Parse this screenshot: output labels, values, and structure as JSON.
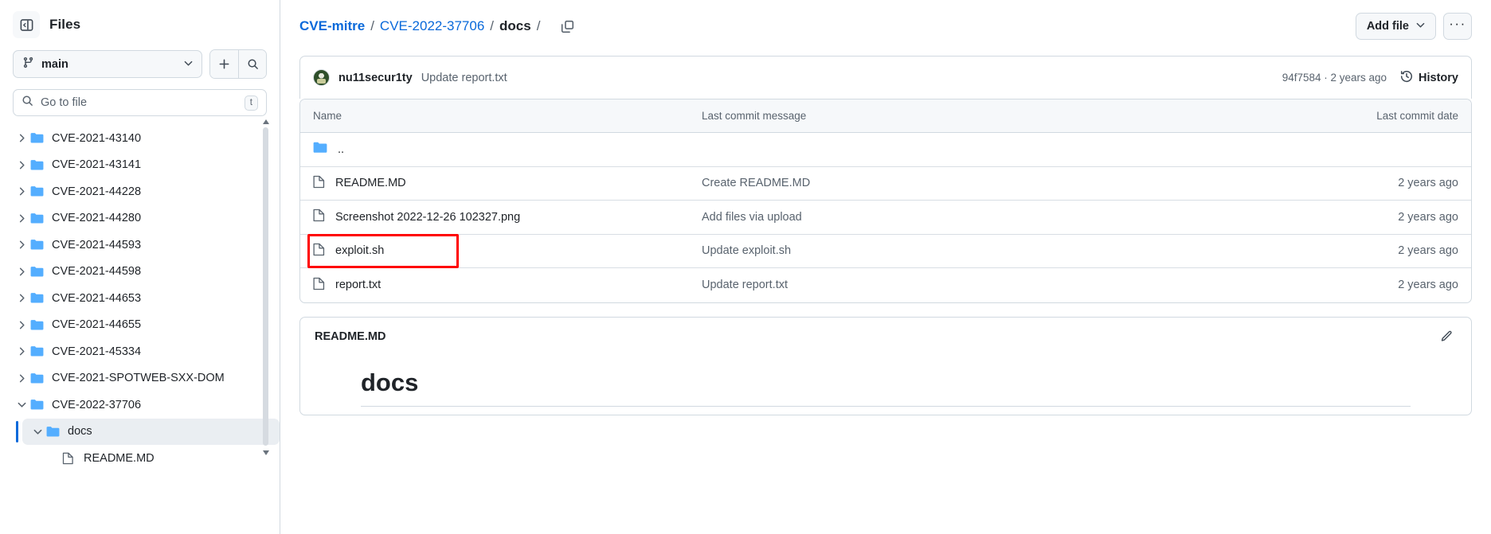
{
  "sidebar": {
    "title": "Files",
    "panel_toggle_icon": "sidebar-collapse-icon",
    "branch": {
      "name": "main",
      "icon": "git-branch-icon",
      "caret_icon": "chevron-down-icon"
    },
    "add_button_icon": "plus-icon",
    "search_button_icon": "search-icon",
    "go_to_file": {
      "placeholder": "Go to file",
      "icon": "search-icon",
      "shortcut": "t"
    },
    "tree": [
      {
        "label": "CVE-2021-43140",
        "type": "folder",
        "expanded": false,
        "selected": false,
        "indent": 0
      },
      {
        "label": "CVE-2021-43141",
        "type": "folder",
        "expanded": false,
        "selected": false,
        "indent": 0
      },
      {
        "label": "CVE-2021-44228",
        "type": "folder",
        "expanded": false,
        "selected": false,
        "indent": 0
      },
      {
        "label": "CVE-2021-44280",
        "type": "folder",
        "expanded": false,
        "selected": false,
        "indent": 0
      },
      {
        "label": "CVE-2021-44593",
        "type": "folder",
        "expanded": false,
        "selected": false,
        "indent": 0
      },
      {
        "label": "CVE-2021-44598",
        "type": "folder",
        "expanded": false,
        "selected": false,
        "indent": 0
      },
      {
        "label": "CVE-2021-44653",
        "type": "folder",
        "expanded": false,
        "selected": false,
        "indent": 0
      },
      {
        "label": "CVE-2021-44655",
        "type": "folder",
        "expanded": false,
        "selected": false,
        "indent": 0
      },
      {
        "label": "CVE-2021-45334",
        "type": "folder",
        "expanded": false,
        "selected": false,
        "indent": 0
      },
      {
        "label": "CVE-2021-SPOTWEB-SXX-DOM",
        "type": "folder",
        "expanded": false,
        "selected": false,
        "indent": 0
      },
      {
        "label": "CVE-2022-37706",
        "type": "folder",
        "expanded": true,
        "selected": false,
        "indent": 0
      },
      {
        "label": "docs",
        "type": "folder",
        "expanded": true,
        "selected": true,
        "indent": 1
      },
      {
        "label": "README.MD",
        "type": "file",
        "expanded": false,
        "selected": false,
        "indent": 2
      }
    ]
  },
  "header": {
    "breadcrumb": [
      {
        "text": "CVE-mitre",
        "style": "link-bold"
      },
      {
        "text": "CVE-2022-37706",
        "style": "link"
      },
      {
        "text": "docs",
        "style": "current"
      }
    ],
    "separator": "/",
    "trailing_separator": "/",
    "copy_path_icon": "copy-icon",
    "add_file_label": "Add file",
    "add_file_caret_icon": "chevron-down-icon",
    "kebab_label": "···"
  },
  "commit_bar": {
    "avatar": "user-avatar",
    "author": "nu11secur1ty",
    "message": "Update report.txt",
    "hash_and_time": "94f7584 · 2 years ago",
    "history_label": "History",
    "history_icon": "clock-history-icon"
  },
  "file_table": {
    "columns": {
      "name": "Name",
      "message": "Last commit message",
      "date": "Last commit date"
    },
    "rows": [
      {
        "name": "..",
        "icon": "folder-icon",
        "message": "",
        "date": "",
        "highlighted": false
      },
      {
        "name": "README.MD",
        "icon": "file-icon",
        "message": "Create README.MD",
        "date": "2 years ago",
        "highlighted": false
      },
      {
        "name": "Screenshot 2022-12-26 102327.png",
        "icon": "file-icon",
        "message": "Add files via upload",
        "date": "2 years ago",
        "highlighted": false
      },
      {
        "name": "exploit.sh",
        "icon": "file-icon",
        "message": "Update exploit.sh",
        "date": "2 years ago",
        "highlighted": true
      },
      {
        "name": "report.txt",
        "icon": "file-icon",
        "message": "Update report.txt",
        "date": "2 years ago",
        "highlighted": false
      }
    ]
  },
  "readme": {
    "title": "README.MD",
    "edit_icon": "pencil-icon",
    "heading": "docs"
  },
  "colors": {
    "link": "#0969da",
    "text": "#1f2328",
    "muted": "#59636e",
    "border": "#d1d9e0",
    "surface": "#f6f8fa",
    "folder": "#54aeff",
    "highlight": "#ff0000"
  }
}
